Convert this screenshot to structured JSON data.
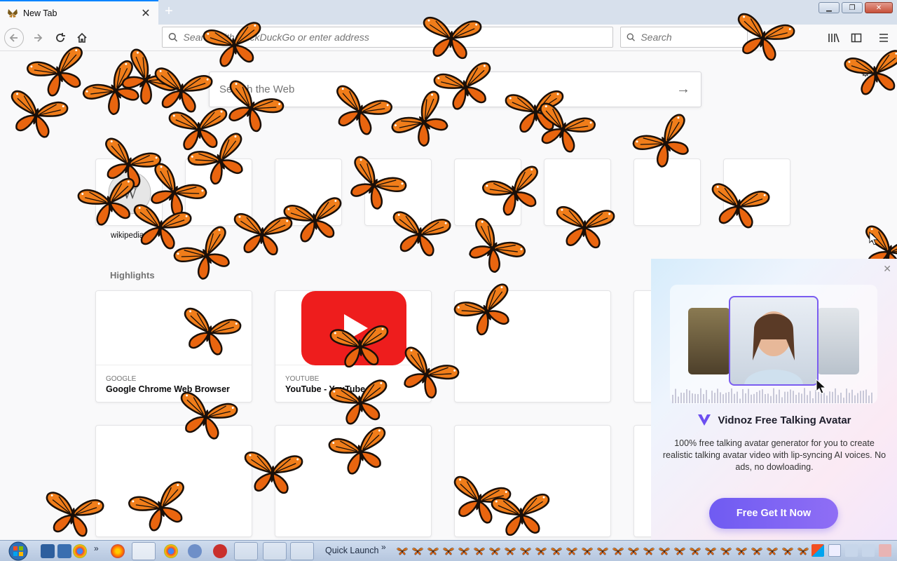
{
  "window": {
    "tab_title": "New Tab",
    "controls": [
      "minimize",
      "restore",
      "close"
    ]
  },
  "toolbar": {
    "url_placeholder": "Search with DuckDuckGo or enter address",
    "search_placeholder": "Search"
  },
  "newtab": {
    "web_search_placeholder": "Search the Web",
    "top_sites": [
      {
        "label": "wikipedia"
      },
      {
        "label": ""
      },
      {
        "label": ""
      },
      {
        "label": ""
      },
      {
        "label": ""
      },
      {
        "label": ""
      }
    ],
    "highlights_title": "Highlights",
    "highlights": [
      {
        "source": "GOOGLE",
        "title": "Google Chrome Web Browser"
      },
      {
        "source": "YOUTUBE",
        "title": "YouTube - YouTube"
      }
    ]
  },
  "popup": {
    "title": "Vidnoz Free Talking Avatar",
    "description": "100% free talking avatar generator for you to create realistic talking avatar video with lip-syncing AI voices. No ads, no dowloading.",
    "cta": "Free Get It Now",
    "accent": "#7a5cf0"
  },
  "taskbar": {
    "quick_launch": "Quick Launch"
  },
  "colors": {
    "butterfly": "#f07d1a",
    "butterfly_vein": "#1a0f08",
    "tab_accent": "#0a84ff"
  }
}
